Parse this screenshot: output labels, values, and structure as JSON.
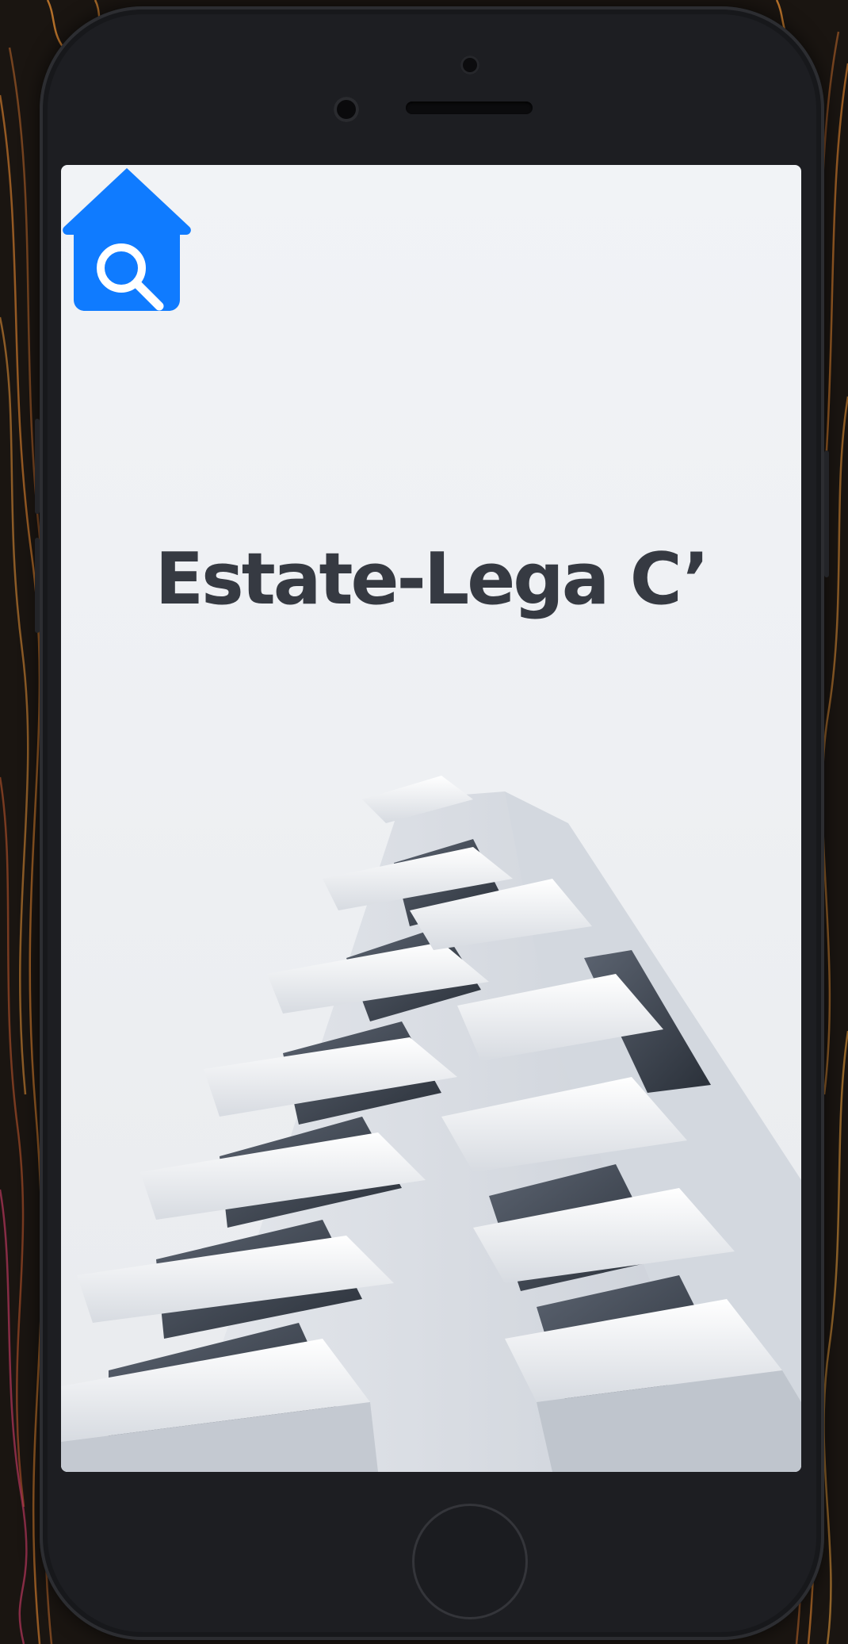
{
  "splash": {
    "app_name": "Estate-Lega C’",
    "logo_icon": "house-search-icon",
    "background_image": "modern-white-apartment-building",
    "logo_color": "#0f7bff",
    "text_color": "#363a42"
  },
  "device": {
    "home_button_icon": "home-button",
    "frame_color": "#1d1e22",
    "background_color": "#1a1511",
    "accent_color": "#e8862a"
  }
}
